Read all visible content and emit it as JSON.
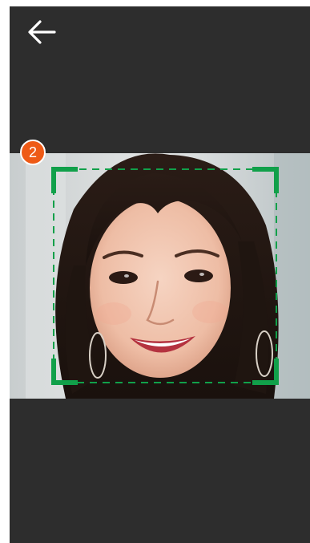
{
  "header": {
    "back_icon": "arrow-left-icon"
  },
  "capture": {
    "step_number": "2",
    "step_badge_color": "#ee5a16",
    "frame_color": "#11a04a",
    "frame_icon": "face-detection-frame-icon"
  },
  "colors": {
    "background": "#2d2d2d",
    "icon": "#ffffff"
  }
}
